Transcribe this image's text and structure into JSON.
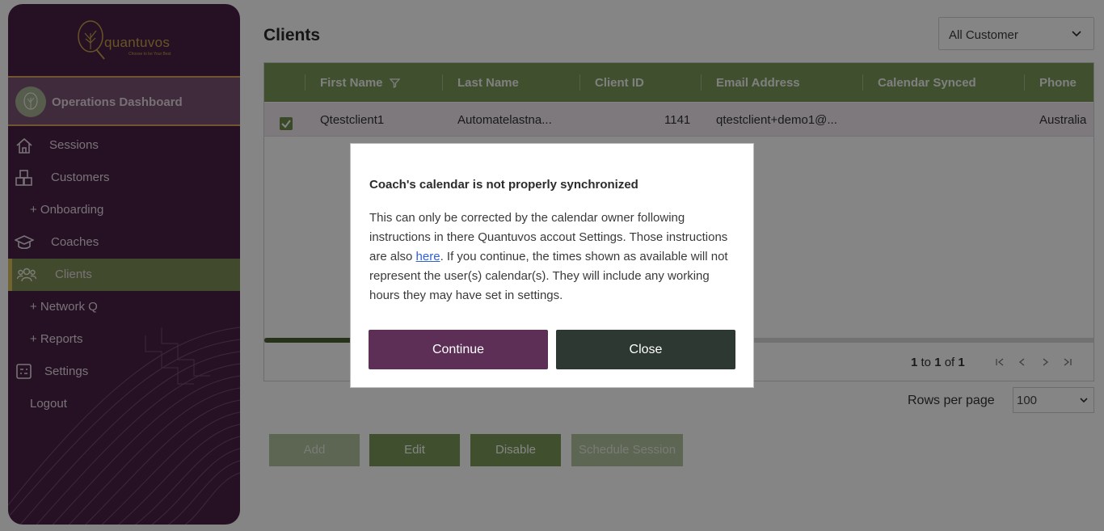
{
  "app": {
    "brand": "quantuvos",
    "tagline": "Choose to be Your Best"
  },
  "sidebar": {
    "dashboard_label": "Operations Dashboard",
    "items": [
      {
        "label": "Sessions",
        "icon": "home-icon"
      },
      {
        "label": "Customers",
        "icon": "boxes-icon"
      },
      {
        "label": "+ Onboarding",
        "icon": ""
      },
      {
        "label": "Coaches",
        "icon": "graduation-cap-icon"
      },
      {
        "label": "Clients",
        "icon": "people-icon",
        "active": true
      },
      {
        "label": "+ Network Q",
        "icon": ""
      },
      {
        "label": "+ Reports",
        "icon": ""
      },
      {
        "label": "Settings",
        "icon": "settings-list-icon"
      },
      {
        "label": "Logout",
        "icon": ""
      }
    ]
  },
  "main": {
    "title": "Clients",
    "filter_value": "All Customer",
    "columns": [
      "First Name",
      "Last Name",
      "Client ID",
      "Email Address",
      "Calendar Synced",
      "Phone"
    ],
    "rows": [
      {
        "checked": true,
        "first_name": "Qtestclient1",
        "last_name": "Automatelastna...",
        "client_id": "1141",
        "email": "qtestclient+demo1@...",
        "calendar_synced": "",
        "phone": "Australia"
      }
    ],
    "pager": {
      "from": "1",
      "to_word": "to",
      "to": "1",
      "of_word": "of",
      "total": "1"
    },
    "rows_per_page_label": "Rows per page",
    "rows_per_page_value": "100",
    "actions": {
      "add": "Add",
      "edit": "Edit",
      "disable": "Disable",
      "schedule": "Schedule Session"
    }
  },
  "modal": {
    "title": "Coach's calendar is not properly synchronized",
    "body_before_link": "This can only be corrected by the calendar owner following instructions in there Quantuvos accout Settings. Those instructions are also ",
    "link_text": "here",
    "body_after_link": ". If you continue, the times shown as available will not represent the user(s) calendar(s). They will include any working hours they may have set in settings.",
    "continue_label": "Continue",
    "close_label": "Close"
  },
  "colors": {
    "sidebar_bg": "#4a2246",
    "accent_green": "#7c9a59",
    "continue_button": "#5d2f57",
    "close_button": "#2d3832",
    "link": "#2f5fd6"
  }
}
